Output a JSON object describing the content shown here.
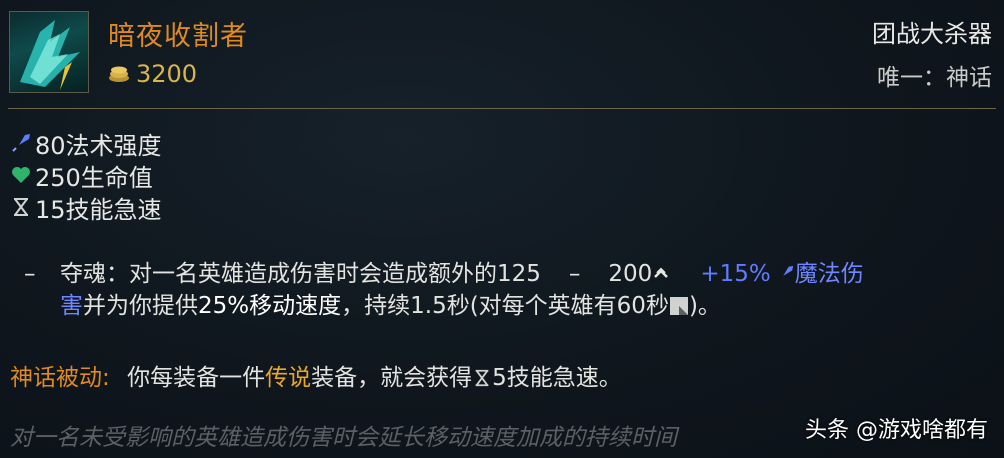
{
  "item": {
    "name": "暗夜收割者",
    "gold": "3200",
    "tag": "团战大杀器",
    "type": "唯一：神话"
  },
  "stats": [
    {
      "icon": "ability-power-icon",
      "value": "80法术强度"
    },
    {
      "icon": "health-icon",
      "value": "250生命值"
    },
    {
      "icon": "ability-haste-icon",
      "value": "15技能急速"
    }
  ],
  "passive": {
    "dash": "–",
    "name": "夺魂：",
    "text1": "对一名英雄造成伤害时会造成额外的125",
    "range_sep": "–",
    "value2": "200",
    "ap_ratio": "+15%",
    "damage_type_a": "魔法伤",
    "damage_type_b": "害",
    "text2": "并为你提供",
    "speed": "25%移动速度",
    "text3": "，持续1.5秒(对每个英雄有60秒",
    "text4": ")。"
  },
  "mythic": {
    "label": "神话被动",
    "colon": ":",
    "text1": "你每装备一件",
    "legendary": "传说",
    "text2": "装备，就会获得",
    "haste": "5技能急速。"
  },
  "footer_text": "对一名未受影响的英雄造成伤害时会延长移动速度加成的持续时间",
  "watermark": "头条 @游戏啥都有",
  "colors": {
    "item_name": "#e08a1f",
    "gold": "#d9b54a",
    "ability_power": "#5f7cff",
    "health": "#2fb36a",
    "background": "#0e141b"
  }
}
